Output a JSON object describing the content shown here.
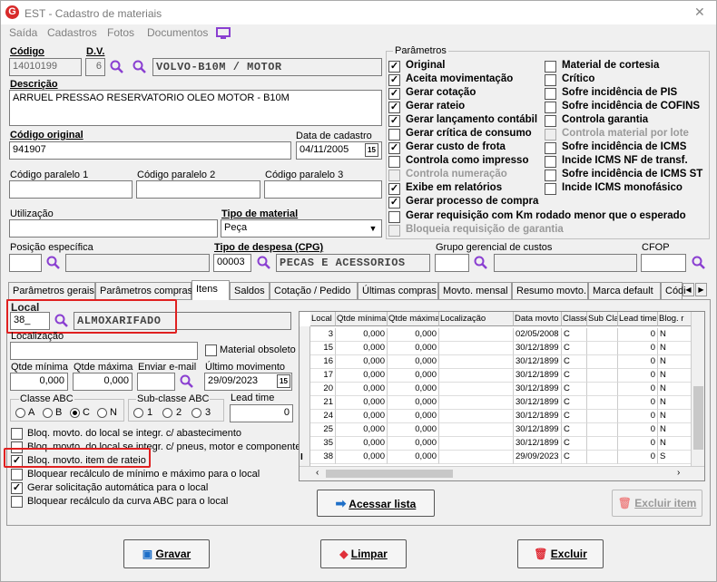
{
  "window": {
    "title": "EST - Cadastro de materiais"
  },
  "menu": [
    "Saída",
    "Cadastros",
    "Fotos",
    "Documentos"
  ],
  "header": {
    "codigo_label": "Código",
    "codigo_value": "14010199",
    "dv_label": "D.V.",
    "dv_value": "6",
    "group_value": "VOLVO-B10M / MOTOR",
    "descricao_label": "Descrição",
    "descricao_value": "ARRUEL PRESSAO RESERVATORIO OLEO MOTOR - B10M",
    "codigo_original_label": "Código original",
    "codigo_original_value": "941907",
    "data_cadastro_label": "Data de cadastro",
    "data_cadastro_value": "04/11/2005",
    "cp1_label": "Código paralelo 1",
    "cp2_label": "Código paralelo 2",
    "cp3_label": "Código paralelo 3",
    "utilizacao_label": "Utilização",
    "tipo_material_label": "Tipo de material",
    "tipo_material_value": "Peça",
    "posicao_label": "Posição específica",
    "tipo_despesa_label": "Tipo de despesa (CPG)",
    "tipo_despesa_code": "00003",
    "tipo_despesa_value": "PECAS E ACESSORIOS",
    "grupo_gerencial_label": "Grupo gerencial de custos",
    "cfop_label": "CFOP",
    "calendar_glyph": "15"
  },
  "parametros": {
    "title": "Parâmetros",
    "left": [
      {
        "label": "Original",
        "checked": true,
        "disabled": false
      },
      {
        "label": "Aceita movimentação",
        "checked": true,
        "disabled": false
      },
      {
        "label": "Gerar cotação",
        "checked": true,
        "disabled": false
      },
      {
        "label": "Gerar rateio",
        "checked": true,
        "disabled": false
      },
      {
        "label": "Gerar lançamento contábil",
        "checked": true,
        "disabled": false
      },
      {
        "label": "Gerar crítica de consumo",
        "checked": false,
        "disabled": false
      },
      {
        "label": "Gerar custo de frota",
        "checked": true,
        "disabled": false
      },
      {
        "label": "Controla como impresso",
        "checked": false,
        "disabled": false
      },
      {
        "label": "Controla numeração",
        "checked": false,
        "disabled": true
      },
      {
        "label": "Exibe em relatórios",
        "checked": true,
        "disabled": false
      },
      {
        "label": "Gerar processo de compra",
        "checked": true,
        "disabled": false
      }
    ],
    "right": [
      {
        "label": "Material de cortesia",
        "checked": false,
        "disabled": false
      },
      {
        "label": "Crítico",
        "checked": false,
        "disabled": false
      },
      {
        "label": "Sofre incidência de PIS",
        "checked": false,
        "disabled": false
      },
      {
        "label": "Sofre incidência de COFINS",
        "checked": false,
        "disabled": false
      },
      {
        "label": "Controla garantia",
        "checked": false,
        "disabled": false
      },
      {
        "label": "Controla material por lote",
        "checked": false,
        "disabled": true
      },
      {
        "label": "Sofre incidência de ICMS",
        "checked": false,
        "disabled": false
      },
      {
        "label": "Incide ICMS NF de transf.",
        "checked": false,
        "disabled": false
      },
      {
        "label": "Sofre incidência de ICMS ST",
        "checked": false,
        "disabled": false
      },
      {
        "label": "Incide ICMS monofásico",
        "checked": false,
        "disabled": false
      }
    ],
    "wide": [
      {
        "label": "Gerar requisição com Km rodado menor que o esperado",
        "checked": false,
        "disabled": false
      },
      {
        "label": "Bloqueia requisição de garantia",
        "checked": false,
        "disabled": true
      }
    ]
  },
  "tabs": [
    "Parâmetros gerais",
    "Parâmetros compras",
    "Itens",
    "Saldos",
    "Cotação / Pedido",
    "Últimas compras",
    "Movto. mensal",
    "Resumo movto.",
    "Marca default",
    "Códi"
  ],
  "itens": {
    "local_label": "Local",
    "local_value": "38_",
    "local_name": "ALMOXARIFADO",
    "localizacao_label": "Localização",
    "material_obsoleto_label": "Material obsoleto",
    "qtde_minima_label": "Qtde mínima",
    "qtde_minima_value": "0,000",
    "qtde_maxima_label": "Qtde máxima",
    "qtde_maxima_value": "0,000",
    "enviar_email_label": "Enviar e-mail",
    "ultimo_movimento_label": "Último movimento",
    "ultimo_movimento_value": "29/09/2023",
    "classe_abc_label": "Classe ABC",
    "classe_abc_options": [
      "A",
      "B",
      "C",
      "N"
    ],
    "classe_abc_selected": "C",
    "subclasse_abc_label": "Sub-classe ABC",
    "subclasse_options": [
      "1",
      "2",
      "3"
    ],
    "lead_time_label": "Lead time",
    "lead_time_value": "0",
    "checks": [
      {
        "label": "Bloq. movto. do local se integr. c/ abastecimento",
        "checked": false
      },
      {
        "label": "Bloq. movto. do local se integr. c/ pneus, motor e componente",
        "checked": false
      },
      {
        "label": "Bloq. movto. item de rateio",
        "checked": true
      },
      {
        "label": "Bloquear recálculo de mínimo e máximo para o local",
        "checked": false
      },
      {
        "label": "Gerar solicitação automática para o local",
        "checked": true
      },
      {
        "label": "Bloquear recálculo da curva ABC para o local",
        "checked": false
      }
    ]
  },
  "grid": {
    "columns": [
      "Local",
      "Qtde mínima",
      "Qtde máxima",
      "Localização",
      "Data movto",
      "Classe",
      "Sub Cla",
      "Lead time",
      "Blog. r"
    ],
    "rows": [
      [
        "3",
        "0,000",
        "0,000",
        "",
        "02/05/2008",
        "C",
        "",
        "0",
        "N"
      ],
      [
        "15",
        "0,000",
        "0,000",
        "",
        "30/12/1899",
        "C",
        "",
        "0",
        "N"
      ],
      [
        "16",
        "0,000",
        "0,000",
        "",
        "30/12/1899",
        "C",
        "",
        "0",
        "N"
      ],
      [
        "17",
        "0,000",
        "0,000",
        "",
        "30/12/1899",
        "C",
        "",
        "0",
        "N"
      ],
      [
        "20",
        "0,000",
        "0,000",
        "",
        "30/12/1899",
        "C",
        "",
        "0",
        "N"
      ],
      [
        "21",
        "0,000",
        "0,000",
        "",
        "30/12/1899",
        "C",
        "",
        "0",
        "N"
      ],
      [
        "24",
        "0,000",
        "0,000",
        "",
        "30/12/1899",
        "C",
        "",
        "0",
        "N"
      ],
      [
        "25",
        "0,000",
        "0,000",
        "",
        "30/12/1899",
        "C",
        "",
        "0",
        "N"
      ],
      [
        "35",
        "0,000",
        "0,000",
        "",
        "30/12/1899",
        "C",
        "",
        "0",
        "N"
      ],
      [
        "38",
        "0,000",
        "0,000",
        "",
        "29/09/2023",
        "C",
        "",
        "0",
        "S"
      ]
    ]
  },
  "buttons": {
    "acessar_lista": "Acessar lista",
    "excluir_item": "Excluir item",
    "gravar": "Gravar",
    "limpar": "Limpar",
    "excluir": "Excluir"
  },
  "colors": {
    "highlight": "#e02020",
    "accent": "#8a3fd1"
  }
}
